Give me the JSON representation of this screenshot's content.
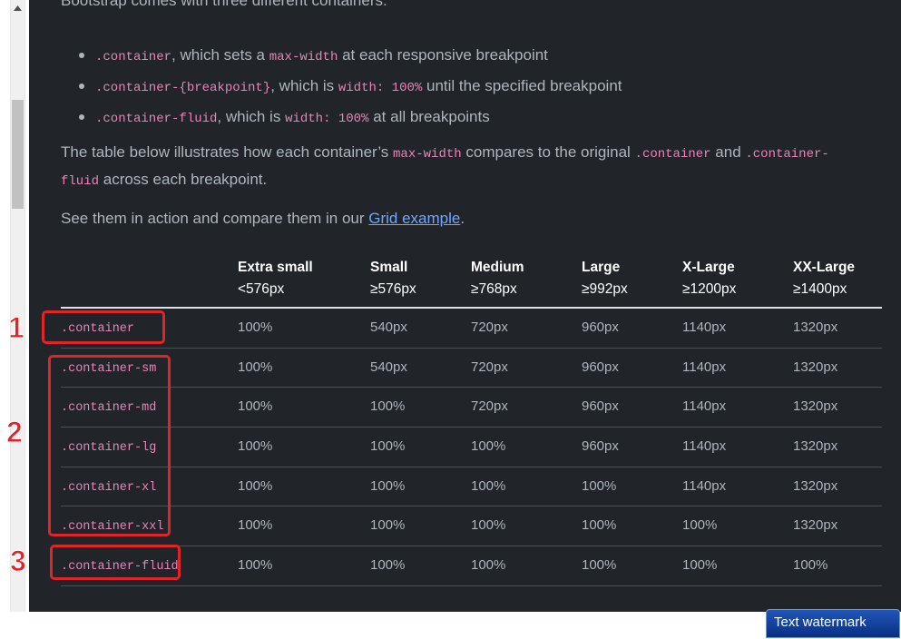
{
  "intro": "Bootstrap comes with three different containers:",
  "bullets": [
    {
      "code": ".container",
      "t1": ", which sets a ",
      "code2": "max-width",
      "t2": " at each responsive breakpoint"
    },
    {
      "code": ".container-{breakpoint}",
      "t1": ", which is ",
      "code2": "width: 100%",
      "t2": " until the specified breakpoint"
    },
    {
      "code": ".container-fluid",
      "t1": ", which is ",
      "code2": "width: 100%",
      "t2": " at all breakpoints"
    }
  ],
  "compare": {
    "t1": "The table below illustrates how each container’s ",
    "code1": "max-width",
    "t2": " compares to the original ",
    "code2": ".container",
    "t3": " and ",
    "code3a": ".container-",
    "code3b": "fluid",
    "t4": " across each breakpoint."
  },
  "grid_para": {
    "t1": "See them in action and compare them in our ",
    "link": "Grid example",
    "t2": "."
  },
  "table": {
    "headers": [
      {
        "name": "Extra small",
        "size": "<576px"
      },
      {
        "name": "Small",
        "size": "≥576px"
      },
      {
        "name": "Medium",
        "size": "≥768px"
      },
      {
        "name": "Large",
        "size": "≥992px"
      },
      {
        "name": "X-Large",
        "size": "≥1200px"
      },
      {
        "name": "XX-Large",
        "size": "≥1400px"
      }
    ],
    "rows": [
      {
        "name": ".container",
        "values": [
          "100%",
          "540px",
          "720px",
          "960px",
          "1140px",
          "1320px"
        ]
      },
      {
        "name": ".container-sm",
        "values": [
          "100%",
          "540px",
          "720px",
          "960px",
          "1140px",
          "1320px"
        ]
      },
      {
        "name": ".container-md",
        "values": [
          "100%",
          "100%",
          "720px",
          "960px",
          "1140px",
          "1320px"
        ]
      },
      {
        "name": ".container-lg",
        "values": [
          "100%",
          "100%",
          "100%",
          "960px",
          "1140px",
          "1320px"
        ]
      },
      {
        "name": ".container-xl",
        "values": [
          "100%",
          "100%",
          "100%",
          "100%",
          "1140px",
          "1320px"
        ]
      },
      {
        "name": ".container-xxl",
        "values": [
          "100%",
          "100%",
          "100%",
          "100%",
          "100%",
          "1320px"
        ]
      },
      {
        "name": ".container-fluid",
        "values": [
          "100%",
          "100%",
          "100%",
          "100%",
          "100%",
          "100%"
        ]
      }
    ]
  },
  "annotations": [
    "1",
    "2",
    "3"
  ],
  "watermark": "Text watermark",
  "colors": {
    "background": "#212529",
    "code": "#e685b5",
    "link": "#6ea8fe",
    "annotation": "#e0252a"
  }
}
